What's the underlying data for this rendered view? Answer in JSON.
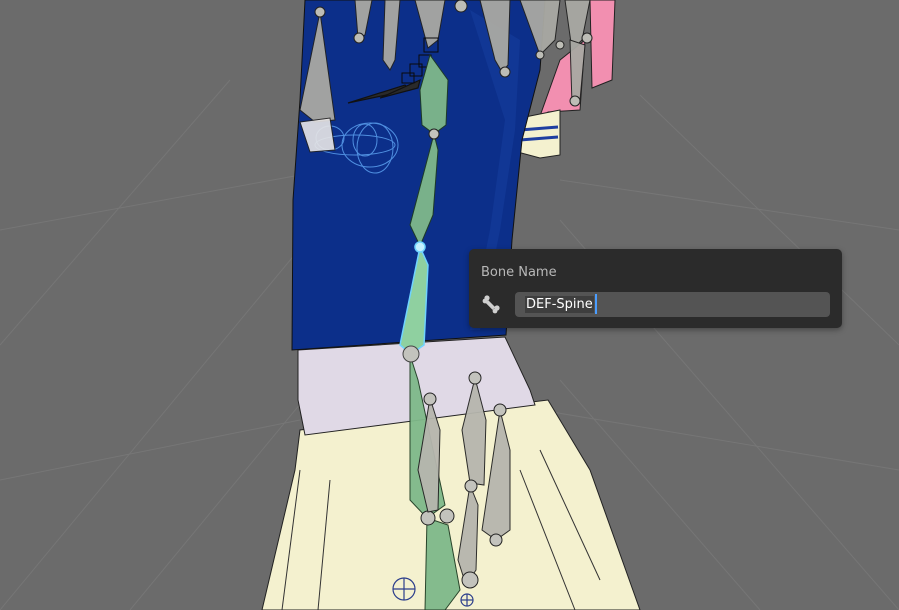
{
  "popup": {
    "title": "Bone Name",
    "field_value": "DEF-Spine",
    "icon": "bone-icon"
  },
  "colors": {
    "viewport_bg": "#6b6b6b",
    "popup_bg": "#2b2b2b",
    "field_bg": "#545454",
    "text_cursor": "#4a9dff",
    "selected_bone_outline": "#6fd3ff",
    "bone_green": "#7fb98a",
    "bone_grey": "#b6b6ae"
  }
}
